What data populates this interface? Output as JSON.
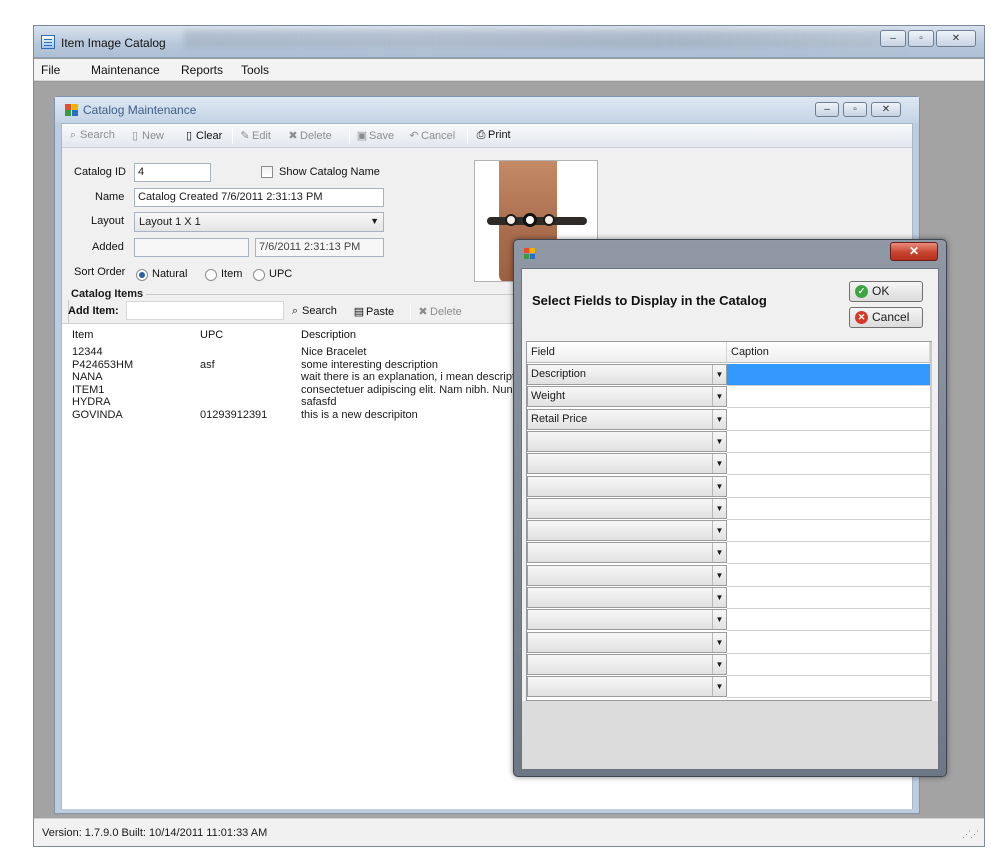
{
  "app": {
    "title": "Item Image Catalog",
    "window_buttons": {
      "minimize": "–",
      "maximize": "▫",
      "close": "✕"
    }
  },
  "menu": [
    "File",
    "Maintenance",
    "Reports",
    "Tools"
  ],
  "catalog_window": {
    "title": "Catalog Maintenance",
    "window_buttons": {
      "minimize": "–",
      "restore": "▫",
      "close": "✕"
    },
    "toolbar": {
      "search": "Search",
      "new": "New",
      "clear": "Clear",
      "edit": "Edit",
      "delete": "Delete",
      "save": "Save",
      "cancel": "Cancel",
      "print": "Print"
    },
    "form": {
      "catalog_id_label": "Catalog ID",
      "catalog_id_value": "4",
      "show_name_label": "Show Catalog Name",
      "name_label": "Name",
      "name_value": "Catalog Created 7/6/2011 2:31:13 PM",
      "layout_label": "Layout",
      "layout_value": "Layout 1 X 1",
      "added_label": "Added",
      "added_value": "",
      "added_date": "7/6/2011 2:31:13 PM",
      "sort_order_label": "Sort Order",
      "sort_options": [
        "Natural",
        "Item",
        "UPC"
      ],
      "sort_selected": "Natural"
    },
    "catalog_items": {
      "group_label": "Catalog Items",
      "add_item_label": "Add Item:",
      "search": "Search",
      "paste": "Paste",
      "delete": "Delete",
      "columns": [
        "Item",
        "UPC",
        "Description"
      ],
      "rows": [
        {
          "item": "12344",
          "upc": "",
          "description": "Nice Bracelet"
        },
        {
          "item": "P424653HM",
          "upc": "asf",
          "description": "some interesting description"
        },
        {
          "item": "NANA",
          "upc": "",
          "description": "wait there is an explanation, i mean descriptio"
        },
        {
          "item": "ITEM1",
          "upc": "",
          "description": "consectetuer adipiscing elit. Nam nibh. Nunc"
        },
        {
          "item": "HYDRA",
          "upc": "",
          "description": "safasfd"
        },
        {
          "item": "GOVINDA",
          "upc": "01293912391",
          "description": "this is a new descripiton"
        }
      ]
    }
  },
  "dialog": {
    "close": "✕",
    "title": "Select Fields to Display in the Catalog",
    "ok": "OK",
    "cancel": "Cancel",
    "columns": [
      "Field",
      "Caption"
    ],
    "rows": [
      {
        "field": "Description",
        "caption": ""
      },
      {
        "field": "Weight",
        "caption": ""
      },
      {
        "field": "Retail Price",
        "caption": ""
      },
      {
        "field": "",
        "caption": ""
      },
      {
        "field": "",
        "caption": ""
      },
      {
        "field": "",
        "caption": ""
      },
      {
        "field": "",
        "caption": ""
      },
      {
        "field": "",
        "caption": ""
      },
      {
        "field": "",
        "caption": ""
      },
      {
        "field": "",
        "caption": ""
      },
      {
        "field": "",
        "caption": ""
      },
      {
        "field": "",
        "caption": ""
      },
      {
        "field": "",
        "caption": ""
      },
      {
        "field": "",
        "caption": ""
      },
      {
        "field": "",
        "caption": ""
      }
    ],
    "selected_row": 0
  },
  "status": {
    "text": "Version: 1.7.9.0 Built: 10/14/2011 11:01:33 AM"
  }
}
